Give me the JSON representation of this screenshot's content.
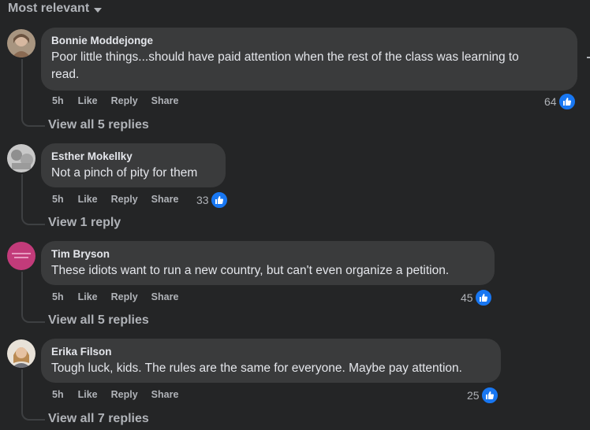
{
  "sort": {
    "label": "Most relevant"
  },
  "colors": {
    "background": "#242526",
    "bubble": "#3a3b3c",
    "like": "#1877f2",
    "secondary_text": "#b0b3b8"
  },
  "comments": [
    {
      "author": "Bonnie Moddejonge",
      "text_line1": "Poor little things...should have paid attention when the rest of the class was learning to",
      "text_line2": "read.",
      "time": "5h",
      "like": "Like",
      "reply": "Reply",
      "share": "Share",
      "reactions": "64",
      "view_replies": "View all 5 replies"
    },
    {
      "author": "Esther Mokellky",
      "text_line1": "Not a pinch of pity for them",
      "time": "5h",
      "like": "Like",
      "reply": "Reply",
      "share": "Share",
      "reactions": "33",
      "view_replies": "View 1 reply"
    },
    {
      "author": "Tim Bryson",
      "text_line1": "These idiots want to run a new country, but can't even organize a petition.",
      "time": "5h",
      "like": "Like",
      "reply": "Reply",
      "share": "Share",
      "reactions": "45",
      "view_replies": "View all 5 replies"
    },
    {
      "author": "Erika Filson",
      "text_line1": "Tough luck, kids. The rules are the same for everyone. Maybe pay attention.",
      "time": "5h",
      "like": "Like",
      "reply": "Reply",
      "share": "Share",
      "reactions": "25",
      "view_replies": "View all 7 replies"
    }
  ]
}
